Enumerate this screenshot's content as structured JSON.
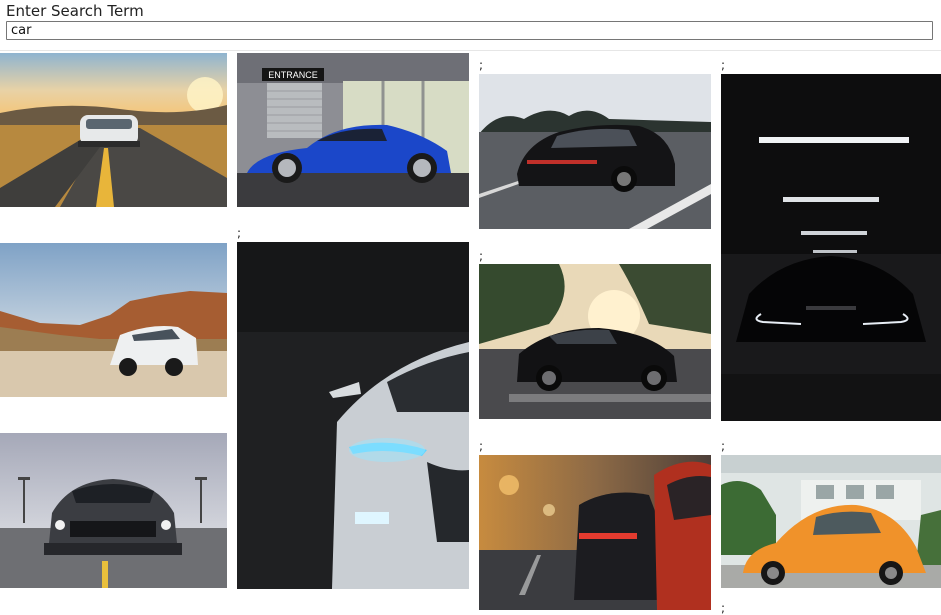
{
  "search": {
    "label": "Enter Search Term",
    "value": "car"
  },
  "separator": ";",
  "results": [
    {
      "subject": "white sports car on winding desert road at sunset",
      "icon": "photo-icon"
    },
    {
      "subject": "blue coupe parked in front of garage entrance",
      "icon": "photo-icon"
    },
    {
      "subject": "black sedan driving on highway",
      "icon": "photo-icon"
    },
    {
      "subject": "black car with headlights on in dark parking garage",
      "icon": "photo-icon"
    },
    {
      "subject": "white SUV in rocky desert landscape",
      "icon": "photo-icon"
    },
    {
      "subject": "white car front with blue LED headlights in dark",
      "icon": "photo-icon"
    },
    {
      "subject": "black muscle car in parking lot at sunset",
      "icon": "photo-icon"
    },
    {
      "subject": "dark grey muscle car front view on road",
      "icon": "photo-icon"
    },
    {
      "subject": "red sports car taillights on city street",
      "icon": "photo-icon"
    },
    {
      "subject": "orange vintage beetle parked by building",
      "icon": "photo-icon"
    }
  ]
}
